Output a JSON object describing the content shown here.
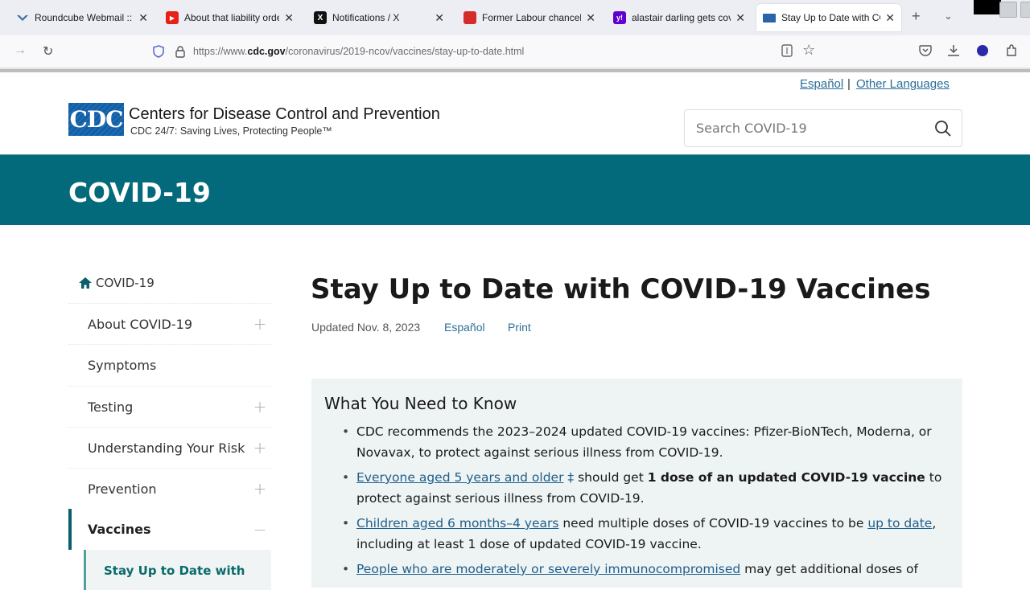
{
  "browser": {
    "tabs": [
      {
        "title": "Roundcube Webmail :: I",
        "favicon": "roundcube-icon"
      },
      {
        "title": "About that liability orde",
        "favicon": "youtube-icon"
      },
      {
        "title": "Notifications / X",
        "favicon": "x-icon"
      },
      {
        "title": "Former Labour chancell",
        "favicon": "news-icon"
      },
      {
        "title": "alastair darling gets covi",
        "favicon": "yahoo-icon"
      },
      {
        "title": "Stay Up to Date with CO",
        "favicon": "cdc-icon",
        "active": true
      }
    ],
    "close_glyph": "✕",
    "new_tab_glyph": "+",
    "list_tabs_glyph": "⌄",
    "url_prefix": "https://www.",
    "url_domain": "cdc.gov",
    "url_path": "/coronavirus/2019-ncov/vaccines/stay-up-to-date.html"
  },
  "header": {
    "lang_espanol": "Español",
    "lang_separator": "|",
    "lang_other": "Other Languages",
    "logo_text": "CDC",
    "org_name": "Centers for Disease Control and Prevention",
    "tagline": "CDC 24/7: Saving Lives, Protecting People™",
    "search_placeholder": "Search COVID-19"
  },
  "banner": {
    "title": "COVID-19"
  },
  "sidebar": {
    "home_label": "COVID-19",
    "items": [
      {
        "label": "About COVID-19",
        "toggle": "+"
      },
      {
        "label": "Symptoms",
        "toggle": ""
      },
      {
        "label": "Testing",
        "toggle": "+"
      },
      {
        "label": "Understanding Your Risk",
        "toggle": "+"
      },
      {
        "label": "Prevention",
        "toggle": "+"
      },
      {
        "label": "Vaccines",
        "toggle": "−",
        "active": true
      }
    ],
    "sub_item": "Stay Up to Date with"
  },
  "main": {
    "title": "Stay Up to Date with COVID-19 Vaccines",
    "updated": "Updated Nov. 8, 2023",
    "espanol_link": "Español",
    "print_link": "Print",
    "box_title": "What You Need to Know",
    "bullets": {
      "b1": "CDC recommends the 2023–2024 updated COVID-19 vaccines: Pfizer-BioNTech, Moderna, or Novavax, to protect against serious illness from COVID-19.",
      "b2_link": "Everyone aged 5 years and older",
      "b2_dagger": "‡",
      "b2_text1": " should get ",
      "b2_bold": "1 dose of an updated COVID-19 vaccine",
      "b2_text2": " to protect against serious illness from COVID-19.",
      "b3_link": "Children aged 6 months–4 years",
      "b3_text1": " need multiple doses of COVID-19 vaccines to be ",
      "b3_link2": "up to date",
      "b3_text2": ", including at least 1 dose of updated COVID-19 vaccine.",
      "b4_link": "People who are moderately or severely immunocompromised",
      "b4_text1": " may get additional doses of"
    }
  },
  "colors": {
    "banner": "#036a7b",
    "link": "#1f5f8b",
    "cdc_blue": "#0f5fa8",
    "active_nav": "#0a5f6b",
    "box_bg": "#eef3f4"
  }
}
